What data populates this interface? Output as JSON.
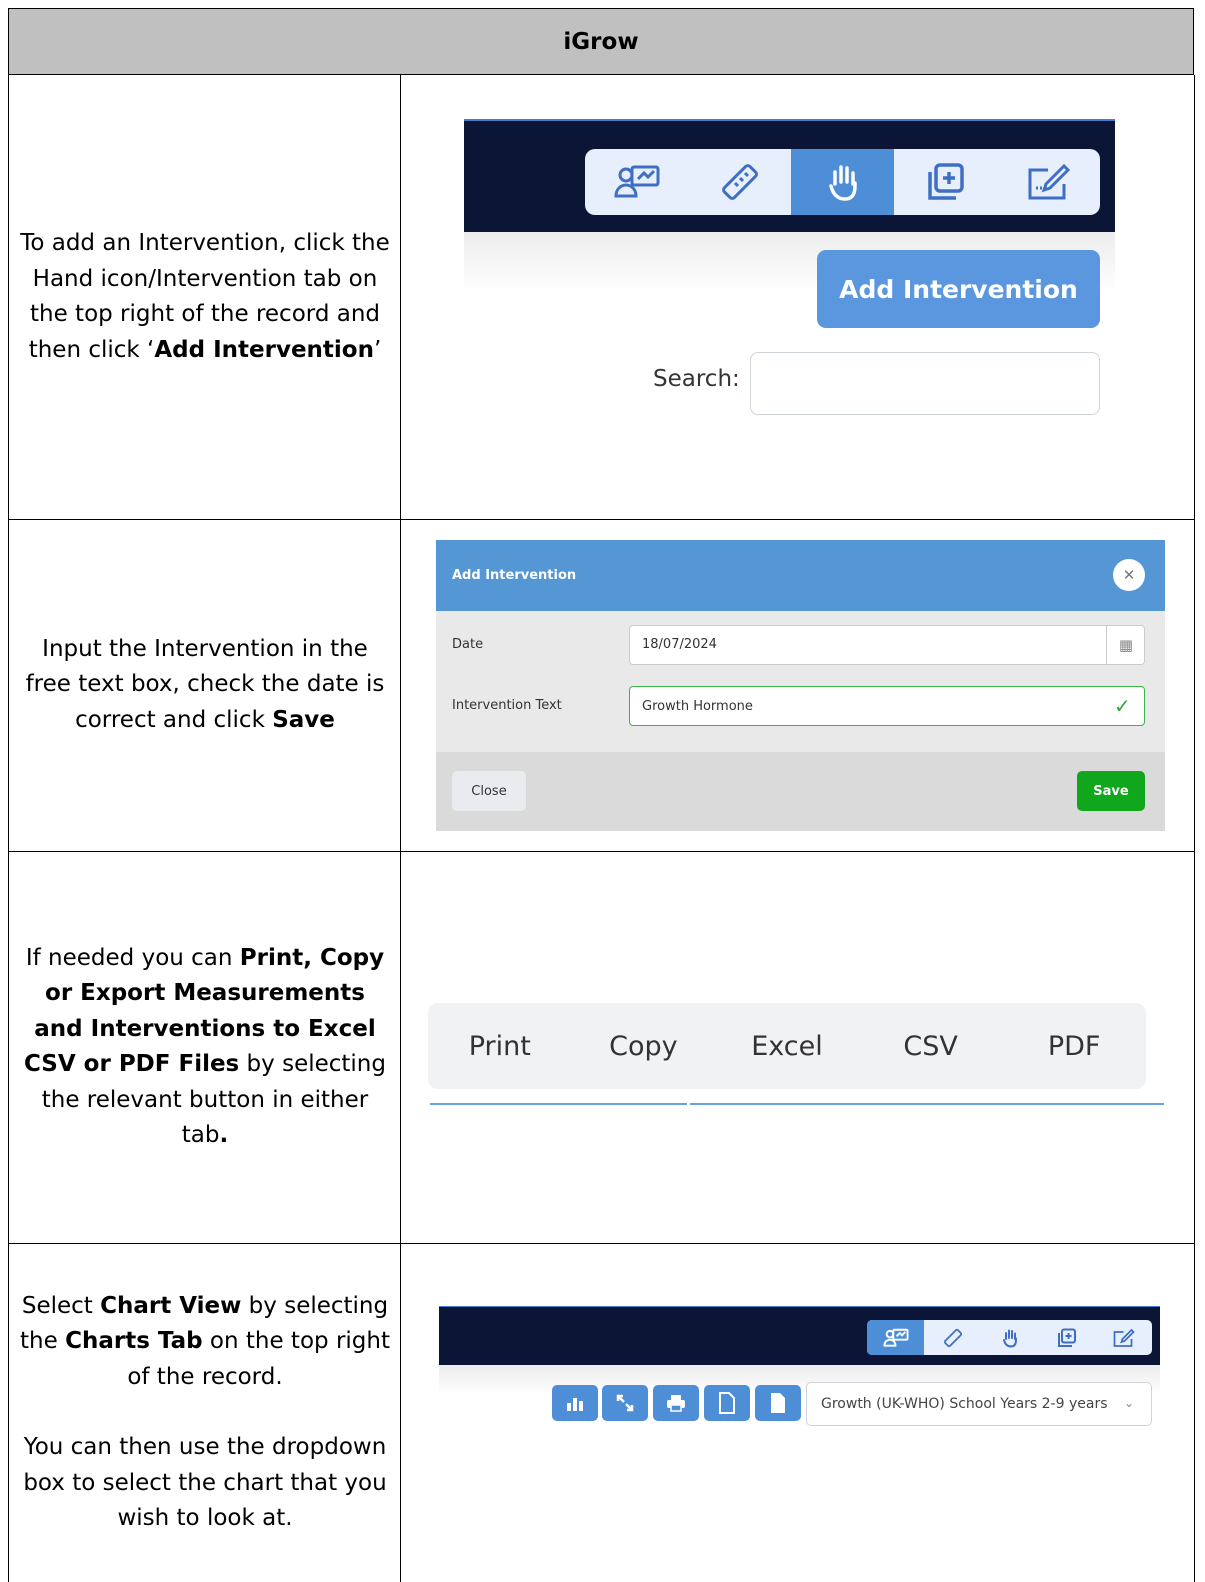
{
  "header": {
    "title": "iGrow"
  },
  "rows": [
    {
      "instruction": {
        "p1": "To add an Intervention, click the Hand icon/Intervention tab on the top right of the record and then click ‘",
        "p1_bold": "Add Intervention",
        "p1_end": "’"
      },
      "screenshot": {
        "tabs": [
          "chart-tab-icon",
          "ruler-tab-icon",
          "hand-tab-icon",
          "add-tab-icon",
          "edit-tab-icon"
        ],
        "active_tab": "hand",
        "add_button_label": "Add Intervention",
        "search_label": "Search:"
      }
    },
    {
      "instruction": {
        "p1": "Input the Intervention in the free text box, check the date is correct and click ",
        "p1_bold": "Save"
      },
      "screenshot": {
        "modal_title": "Add Intervention",
        "date_label": "Date",
        "date_value": "18/07/2024",
        "text_label": "Intervention Text",
        "text_value": "Growth Hormone",
        "close_label": "Close",
        "save_label": "Save"
      }
    },
    {
      "instruction": {
        "p1": "If needed you can ",
        "p1_bold": "Print, Copy or Export Measurements and Interventions to Excel CSV or PDF Files",
        "p1_end": " by selecting the relevant button in either tab",
        "p1_end_bold": "."
      },
      "screenshot": {
        "buttons": [
          "Print",
          "Copy",
          "Excel",
          "CSV",
          "PDF"
        ]
      }
    },
    {
      "instruction": {
        "p1": "Select ",
        "p1_bold": "Chart View",
        "p1_mid": " by selecting the ",
        "p1_bold2": "Charts Tab",
        "p1_end": " on the top right of the record.",
        "p2": "You can then use the dropdown box to select the chart that you wish to look at."
      },
      "screenshot": {
        "active_tab": "chart",
        "chart_select_value": "Growth (UK-WHO) School Years 2-9 years"
      }
    }
  ]
}
